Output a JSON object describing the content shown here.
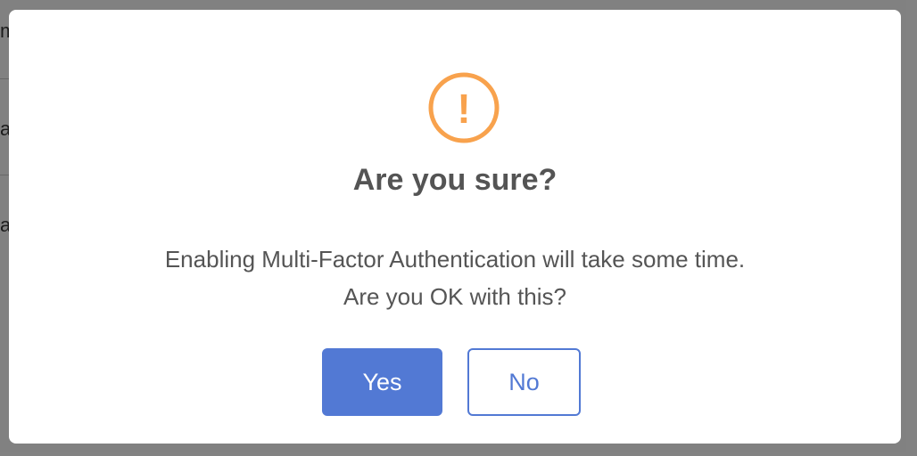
{
  "background": {
    "row_fragments": [
      "m",
      "a",
      "a"
    ]
  },
  "dialog": {
    "icon": "exclamation-circle-icon",
    "icon_glyph": "!",
    "icon_color": "#f8a24d",
    "title": "Are you sure?",
    "message_line_1": "Enabling Multi-Factor Authentication will take some time.",
    "message_line_2": "Are you OK with this?",
    "confirm_label": "Yes",
    "cancel_label": "No",
    "accent_color": "#5279d4"
  }
}
